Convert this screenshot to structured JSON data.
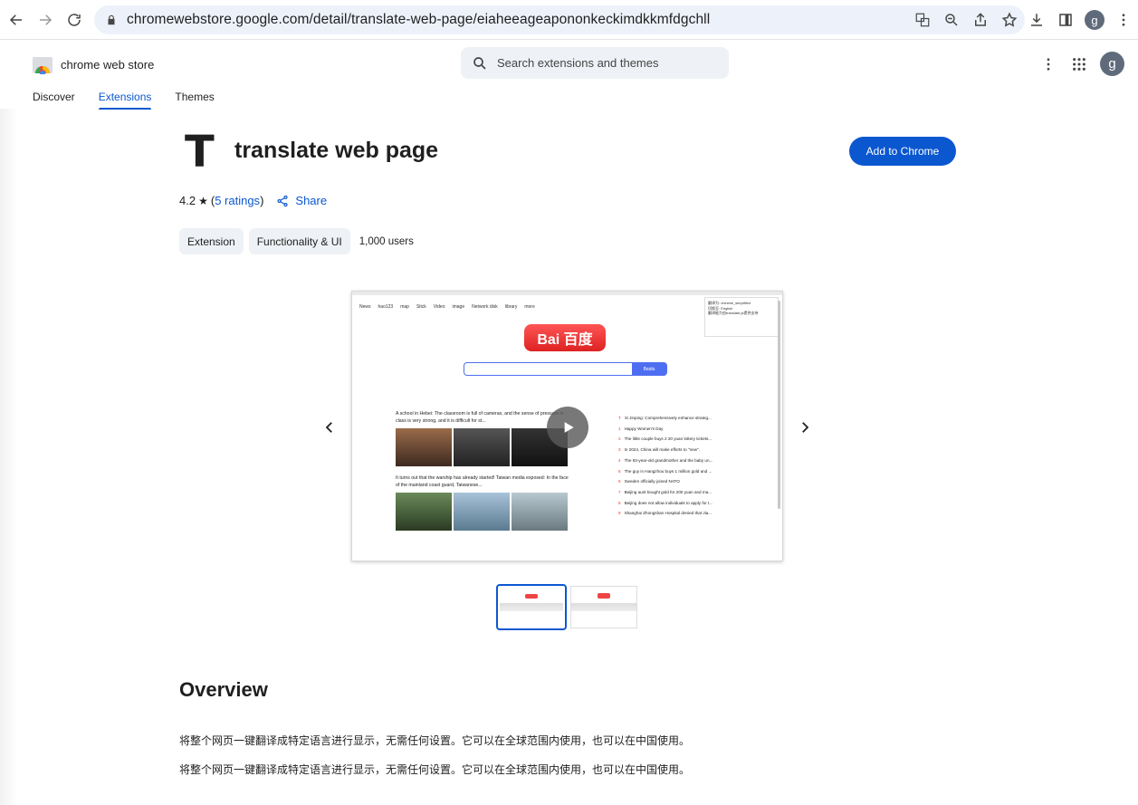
{
  "browser": {
    "url": "chromewebstore.google.com/detail/translate-web-page/eiaheeageapononkeckimdkkmfdgchll",
    "profile_initial": "g"
  },
  "store": {
    "logo_text": "chrome web store",
    "search_placeholder": "Search extensions and themes",
    "profile_initial": "g",
    "tabs": [
      {
        "label": "Discover",
        "active": false
      },
      {
        "label": "Extensions",
        "active": true
      },
      {
        "label": "Themes",
        "active": false
      }
    ]
  },
  "extension": {
    "icon_letter": "T",
    "title": "translate web page",
    "add_button": "Add to Chrome",
    "rating": "4.2",
    "ratings_link": "5 ratings",
    "share_label": "Share",
    "chips": [
      "Extension",
      "Functionality & UI"
    ],
    "users": "1,000 users"
  },
  "screenshot": {
    "nav_items": [
      "News",
      "hao123",
      "map",
      "Stick",
      "Video",
      "image",
      "Network disk",
      "library",
      "more"
    ],
    "logo": "Bai 百度",
    "search_button": "Baidu",
    "panel_lines": [
      "翻译为: chinese_simplified",
      "切换至: English",
      "翻译能力由translate.js提供支持"
    ],
    "left_headline_1": "A school in Hebei: The classroom is full of cameras, and the sense of pressure in class is very strong, and it is difficult for st...",
    "left_headline_2": "It turns out that the warship has already started! Taiwan media exposed: In the face of the mainland coast guard, Taiwanese...",
    "right_items": [
      "Xi Jinping: Comprehensively enhance strateg...",
      "Happy Women's Day",
      "The little couple buys 2 20 yuan lottery tickets...",
      "In 2024, China will make efforts to \"new\".",
      "The 93-year-old grandmother and the baby un...",
      "The guy in Hangzhou buys 1 million gold and ...",
      "Sweden officially joined NATO",
      "Beijing aunt bought gold for 200 yuan and ma...",
      "Beijing does not allow individuals to apply for t...",
      "Shanghai Zhongshan Hospital denied that Jia..."
    ]
  },
  "overview": {
    "heading": "Overview",
    "paragraphs": [
      "将整个网页一键翻译成特定语言进行显示，无需任何设置。它可以在全球范围内使用，也可以在中国使用。",
      "将整个网页一键翻译成特定语言进行显示，无需任何设置。它可以在全球范围内使用，也可以在中国使用。"
    ]
  },
  "colors": {
    "accent": "#0b57d0",
    "chip_bg": "#eef1f6"
  }
}
